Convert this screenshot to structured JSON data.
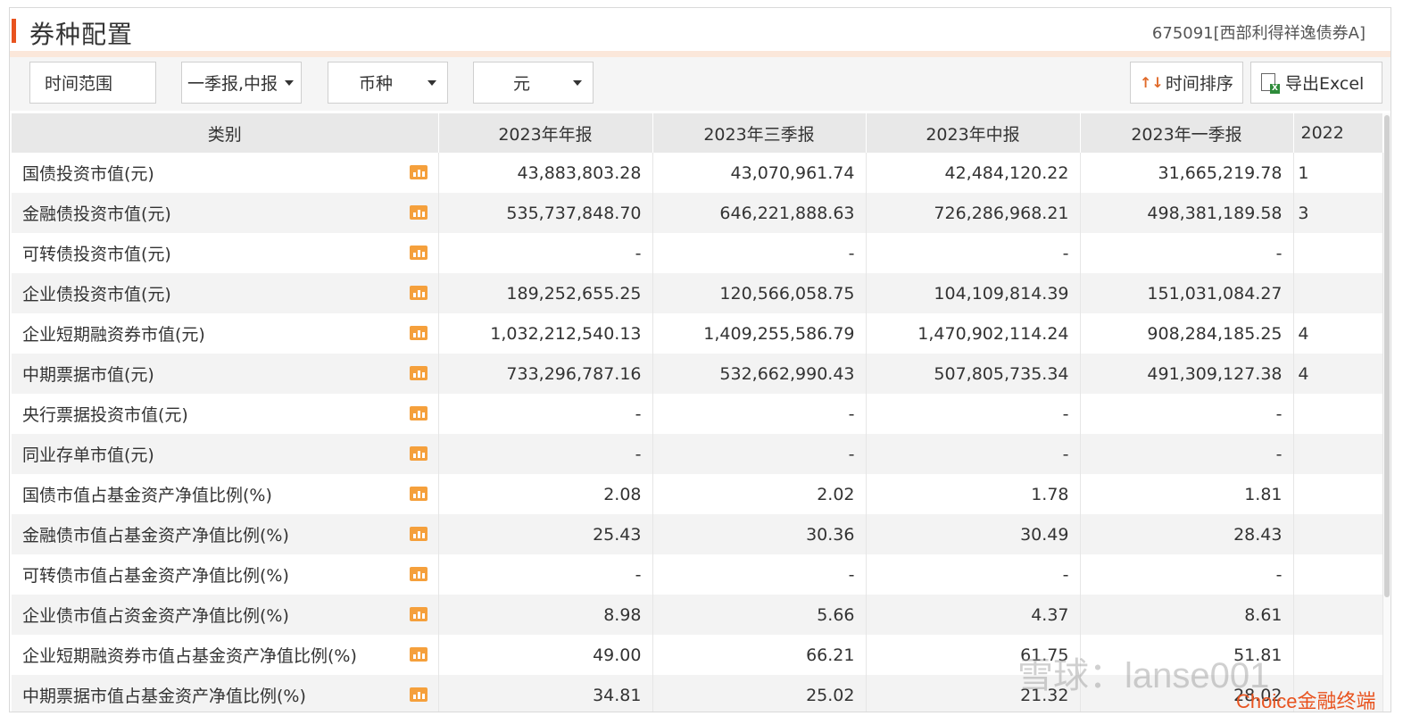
{
  "header": {
    "title": "券种配置",
    "fund_code": "675091[西部利得祥逸债券A]"
  },
  "toolbar": {
    "time_range_label": "时间范围",
    "report_select": "一季报,中报",
    "currency_select": "币种",
    "unit_select": "元",
    "sort_button": "时间排序",
    "export_button": "导出Excel"
  },
  "table": {
    "columns": [
      "类别",
      "2023年年报",
      "2023年三季报",
      "2023年中报",
      "2023年一季报",
      "2022"
    ],
    "rows": [
      {
        "cat": "国债投资市值(元)",
        "v": [
          "43,883,803.28",
          "43,070,961.74",
          "42,484,120.22",
          "31,665,219.78",
          "1"
        ]
      },
      {
        "cat": "金融债投资市值(元)",
        "v": [
          "535,737,848.70",
          "646,221,888.63",
          "726,286,968.21",
          "498,381,189.58",
          "3"
        ]
      },
      {
        "cat": "可转债投资市值(元)",
        "v": [
          "-",
          "-",
          "-",
          "-",
          ""
        ]
      },
      {
        "cat": "企业债投资市值(元)",
        "v": [
          "189,252,655.25",
          "120,566,058.75",
          "104,109,814.39",
          "151,031,084.27",
          ""
        ]
      },
      {
        "cat": "企业短期融资券市值(元)",
        "v": [
          "1,032,212,540.13",
          "1,409,255,586.79",
          "1,470,902,114.24",
          "908,284,185.25",
          "4"
        ]
      },
      {
        "cat": "中期票据市值(元)",
        "v": [
          "733,296,787.16",
          "532,662,990.43",
          "507,805,735.34",
          "491,309,127.38",
          "4"
        ]
      },
      {
        "cat": "央行票据投资市值(元)",
        "v": [
          "-",
          "-",
          "-",
          "-",
          ""
        ]
      },
      {
        "cat": "同业存单市值(元)",
        "v": [
          "-",
          "-",
          "-",
          "-",
          ""
        ]
      },
      {
        "cat": "国债市值占基金资产净值比例(%)",
        "v": [
          "2.08",
          "2.02",
          "1.78",
          "1.81",
          ""
        ]
      },
      {
        "cat": "金融债市值占基金资产净值比例(%)",
        "v": [
          "25.43",
          "30.36",
          "30.49",
          "28.43",
          ""
        ]
      },
      {
        "cat": "可转债市值占基金资产净值比例(%)",
        "v": [
          "-",
          "-",
          "-",
          "-",
          ""
        ]
      },
      {
        "cat": "企业债市值占资金资产净值比例(%)",
        "v": [
          "8.98",
          "5.66",
          "4.37",
          "8.61",
          ""
        ]
      },
      {
        "cat": "企业短期融资券市值占基金资产净值比例(%)",
        "v": [
          "49.00",
          "66.21",
          "61.75",
          "51.81",
          ""
        ]
      },
      {
        "cat": "中期票据市值占基金资产净值比例(%)",
        "v": [
          "34.81",
          "25.02",
          "21.32",
          "28.02",
          ""
        ]
      }
    ]
  },
  "watermark": "雪球：lanse001",
  "brand": "Choice金融终端",
  "colors": {
    "accent": "#e8531f",
    "chart_icon": "#f5a03c"
  }
}
